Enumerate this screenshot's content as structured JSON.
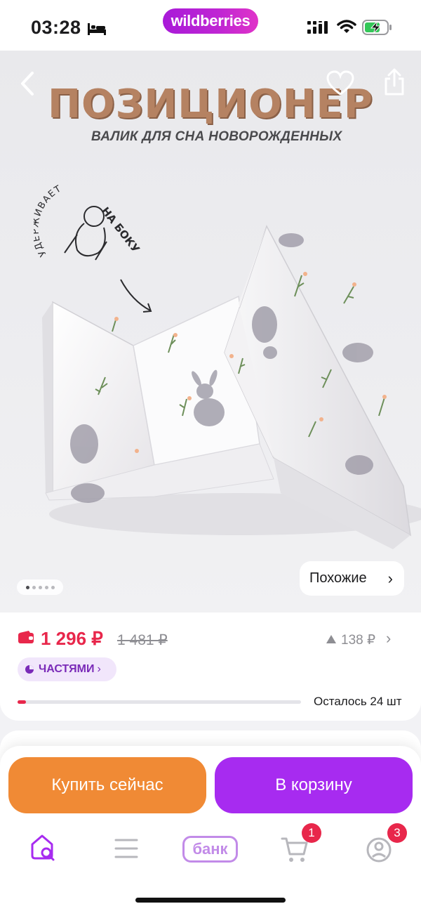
{
  "status_bar": {
    "time": "03:28",
    "app_logo": "wildberries",
    "icons": [
      "bed-icon",
      "cellular-signal-icon",
      "wifi-icon",
      "battery-charging-icon"
    ]
  },
  "gallery": {
    "promo_title": "ПОЗИЦИОНЕР",
    "promo_subtitle": "ВАЛИК ДЛЯ СНА НОВОРОЖДЕННЫХ",
    "badge_text_arc": "УДЕРЖИВАЕТ",
    "badge_text_bold": "НА БОКУ",
    "dots_count": 5,
    "active_dot": 0,
    "similar_label": "Похожие",
    "icons": [
      "back-arrow-icon",
      "heart-icon",
      "share-icon"
    ]
  },
  "price": {
    "current": "1 296 ₽",
    "old": "1 481 ₽",
    "difference": "138 ₽",
    "installments_label": "ЧАСТЯМИ",
    "stock_fill_fraction": 0.03,
    "stock_label": "Осталось 24 шт",
    "icons": [
      "wallet-icon",
      "triangle-up-icon",
      "chevron-right-icon",
      "pie-chart-icon"
    ]
  },
  "actions": {
    "buy_now": "Купить сейчас",
    "add_to_cart": "В корзину"
  },
  "tab_bar": {
    "bank_label": "банк",
    "cart_badge": "1",
    "profile_badge": "3",
    "icons": [
      "home-search-icon",
      "menu-icon",
      "bank-icon",
      "cart-icon",
      "profile-icon"
    ]
  },
  "colors": {
    "brand_purple": "#a72bf0",
    "buy_orange": "#f08a35",
    "price_red": "#e8274b",
    "promo_brown": "#b58262"
  }
}
